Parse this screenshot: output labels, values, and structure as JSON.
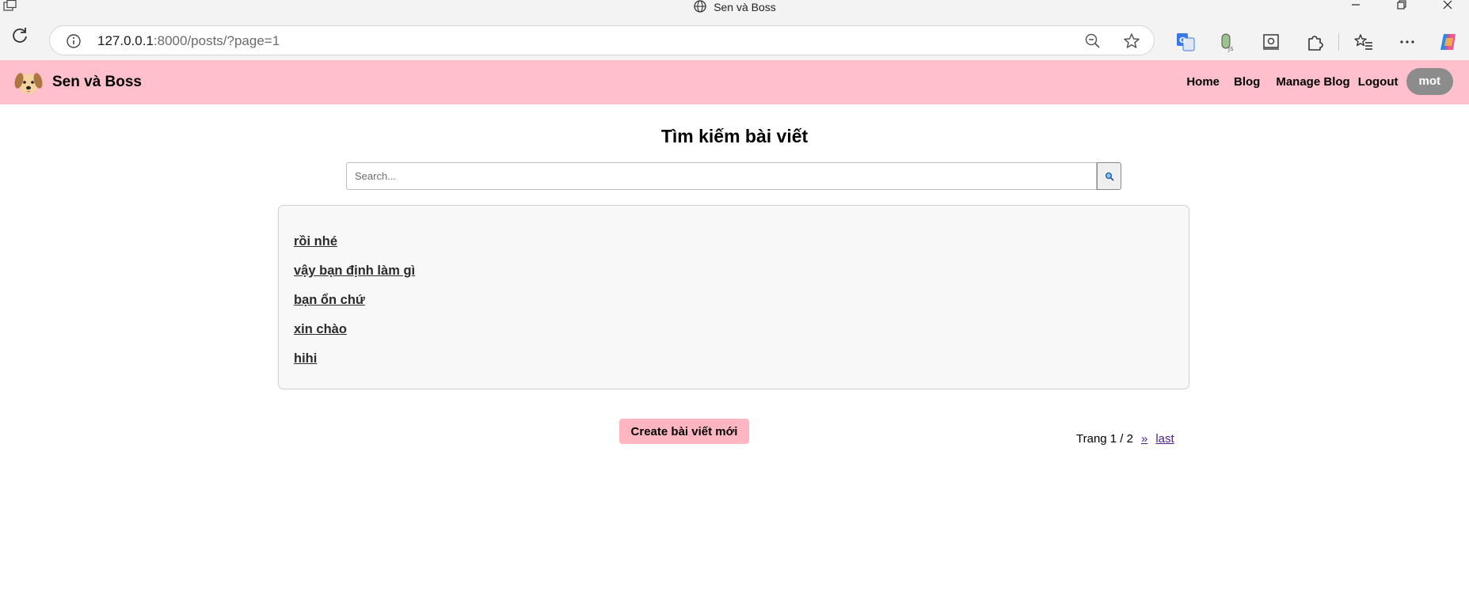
{
  "window": {
    "title": "Sen và Boss"
  },
  "browser": {
    "url_host": "127.0.0.1",
    "url_rest": ":8000/posts/?page=1"
  },
  "header": {
    "site_name": "Sen và Boss",
    "nav": {
      "home": "Home",
      "blog": "Blog",
      "manage": "Manage Blog",
      "logout": "Logout"
    },
    "user": "mot"
  },
  "main": {
    "title": "Tìm kiếm bài viết",
    "search": {
      "placeholder": "Search..."
    },
    "posts": [
      "rồi nhé",
      "vậy bạn định làm gì",
      "bạn ổn chứ",
      "xin chào",
      "hihi"
    ],
    "create_button": "Create bài viết mới",
    "pagination": {
      "text": "Trang 1 / 2",
      "next": "»",
      "last": "last"
    }
  },
  "colors": {
    "header_bg": "#ffc0cb",
    "create_btn_bg": "#ffb6c1",
    "user_badge_bg": "#8c8c8c"
  },
  "icons": [
    "app-icon",
    "globe-icon",
    "reload-icon",
    "info-icon",
    "zoom-out-icon",
    "favorite-star-icon",
    "translate-icon",
    "extension-js-icon",
    "screenshot-icon",
    "extensions-icon",
    "favorites-icon",
    "more-icon",
    "copilot-icon",
    "dog-logo-icon",
    "search-icon"
  ]
}
